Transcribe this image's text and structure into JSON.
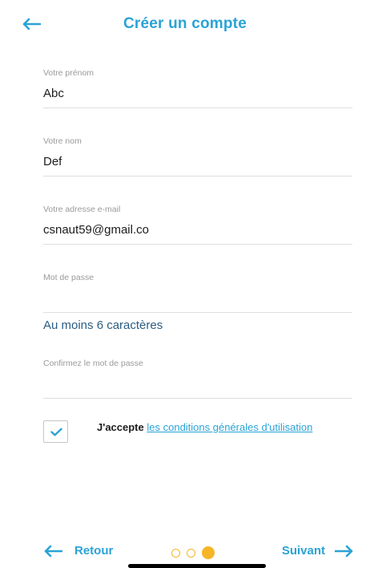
{
  "header": {
    "title": "Créer un compte",
    "back_icon": "arrow-left-icon"
  },
  "form": {
    "first_name": {
      "label": "Votre prénom",
      "value": "Abc"
    },
    "last_name": {
      "label": "Votre nom",
      "value": "Def"
    },
    "email": {
      "label": "Votre adresse e-mail",
      "value": "csnaut59@gmail.co"
    },
    "password": {
      "label": "Mot de passe",
      "value": ""
    },
    "password_hint": "Au moins 6 caractères",
    "confirm_password": {
      "label": "Confirmez le mot de passe",
      "value": ""
    }
  },
  "terms": {
    "checked": true,
    "prefix": "J'accepte",
    "link": "les conditions générales d'utilisation"
  },
  "footer": {
    "back_label": "Retour",
    "next_label": "Suivant",
    "step_current": 3,
    "step_total": 3
  },
  "colors": {
    "accent": "#2aa3d6",
    "dot": "#f6b526",
    "hint": "#2c5d83"
  }
}
